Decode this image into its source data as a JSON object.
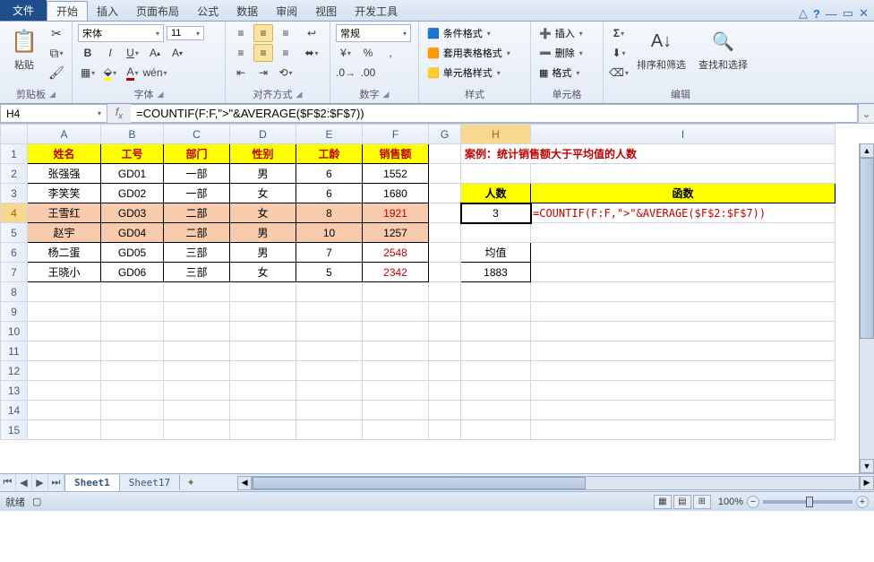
{
  "tabs": {
    "file": "文件",
    "list": [
      "开始",
      "插入",
      "页面布局",
      "公式",
      "数据",
      "审阅",
      "视图",
      "开发工具"
    ],
    "active": 0
  },
  "titlebar": {
    "help": "?"
  },
  "ribbon": {
    "clipboard": {
      "paste": "粘贴",
      "label": "剪贴板"
    },
    "font": {
      "name": "宋体",
      "size": "11",
      "label": "字体"
    },
    "align": {
      "label": "对齐方式"
    },
    "number": {
      "format": "常规",
      "label": "数字"
    },
    "styles": {
      "cond": "条件格式",
      "table": "套用表格格式",
      "cell": "单元格样式",
      "label": "样式"
    },
    "cells": {
      "insert": "插入",
      "delete": "删除",
      "format": "格式",
      "label": "单元格"
    },
    "editing": {
      "sort": "排序和筛选",
      "find": "查找和选择",
      "label": "编辑"
    }
  },
  "namebox": "H4",
  "formula": "=COUNTIF(F:F,\">\"&AVERAGE($F$2:$F$7))",
  "cols": [
    "A",
    "B",
    "C",
    "D",
    "E",
    "F",
    "G",
    "H",
    "I"
  ],
  "headers": [
    "姓名",
    "工号",
    "部门",
    "性别",
    "工龄",
    "销售额"
  ],
  "rows": [
    {
      "r": 2,
      "d": [
        "张强强",
        "GD01",
        "一部",
        "男",
        "6",
        "1552"
      ]
    },
    {
      "r": 3,
      "d": [
        "李笑笑",
        "GD02",
        "一部",
        "女",
        "6",
        "1680"
      ]
    },
    {
      "r": 4,
      "d": [
        "王雪红",
        "GD03",
        "二部",
        "女",
        "8",
        "1921"
      ],
      "pink": true,
      "red": true
    },
    {
      "r": 5,
      "d": [
        "赵宇",
        "GD04",
        "二部",
        "男",
        "10",
        "1257"
      ],
      "pink": true
    },
    {
      "r": 6,
      "d": [
        "杨二蛋",
        "GD05",
        "三部",
        "男",
        "7",
        "2548"
      ],
      "red": true
    },
    {
      "r": 7,
      "d": [
        "王晓小",
        "GD06",
        "三部",
        "女",
        "5",
        "2342"
      ],
      "red": true
    }
  ],
  "side": {
    "title": "案例：统计销售额大于平均值的人数",
    "h1": "人数",
    "h2": "函数",
    "count": "3",
    "formula": "=COUNTIF(F:F,\">\"&AVERAGE($F$2:$F$7))",
    "avglbl": "均值",
    "avg": "1883"
  },
  "sheets": {
    "list": [
      "Sheet1",
      "Sheet17"
    ],
    "active": 0
  },
  "status": {
    "ready": "就绪",
    "zoom": "100%"
  }
}
